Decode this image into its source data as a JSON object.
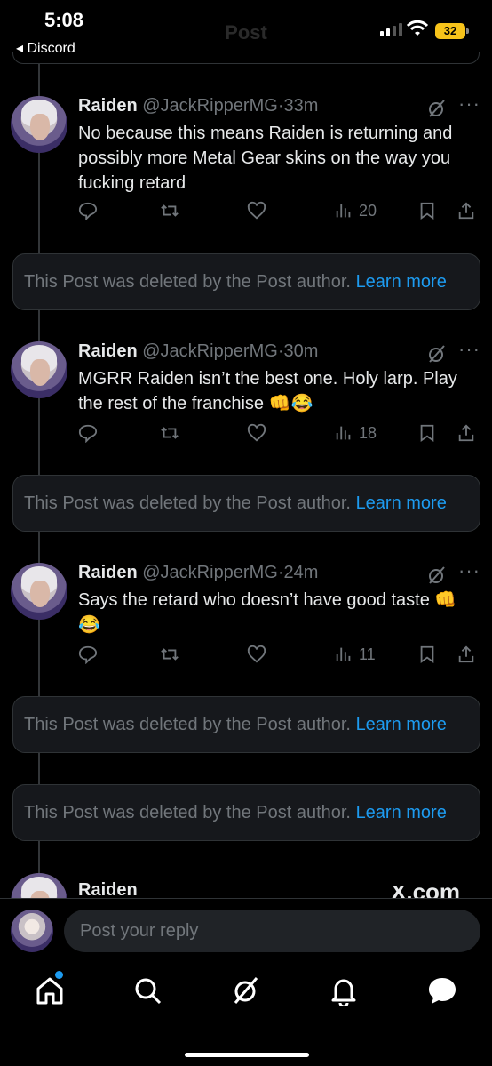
{
  "status_bar": {
    "time": "5:08",
    "back_label": "◂ Discord",
    "battery": "32",
    "ghost_title": "Post"
  },
  "tweets": [
    {
      "name": "Raiden",
      "handle": "@JackRipperMG",
      "time": "33m",
      "text": "No because this means Raiden is returning and possibly more Metal Gear skins on the way you fucking retard",
      "views": "20"
    },
    {
      "name": "Raiden",
      "handle": "@JackRipperMG",
      "time": "30m",
      "text": "MGRR Raiden isn’t the best one. Holy larp. Play the rest of the franchise 👊😂",
      "views": "18"
    },
    {
      "name": "Raiden",
      "handle": "@JackRipperMG",
      "time": "24m",
      "text": "Says the retard who doesn’t have good taste 👊😂",
      "views": "11"
    }
  ],
  "deleted_notice": {
    "text": "This Post was deleted by the Post author.",
    "link": "Learn more"
  },
  "partial_tweet": {
    "name": "Raiden",
    "watermark": "X.com"
  },
  "reply": {
    "placeholder": "Post your reply"
  },
  "tabs": [
    {
      "icon": "home-icon"
    },
    {
      "icon": "search-icon"
    },
    {
      "icon": "grok-icon"
    },
    {
      "icon": "bell-icon"
    },
    {
      "icon": "chat-icon"
    }
  ],
  "colors": {
    "accent": "#1d9bf0",
    "muted": "#71767b",
    "text": "#e7e9ea",
    "card": "#16181c"
  }
}
